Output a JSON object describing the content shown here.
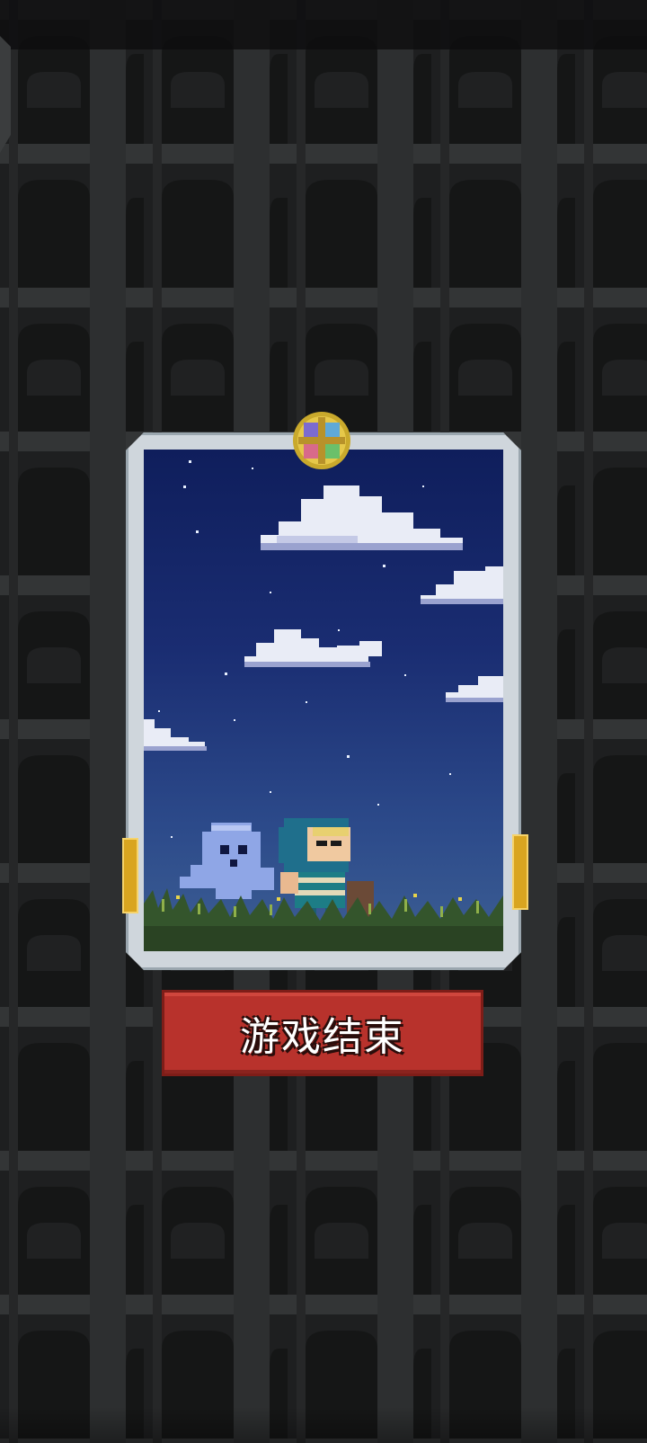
{
  "game_over": {
    "button_label": "游戏结束"
  },
  "colors": {
    "background": "#1b1c1d",
    "button": "#b8322c",
    "night_sky": "#0f1e5c",
    "frame": "#cfd6dc"
  },
  "icons": {
    "medal": "medal-icon",
    "ghost": "ghost-sprite",
    "hero": "hero-sprite"
  }
}
